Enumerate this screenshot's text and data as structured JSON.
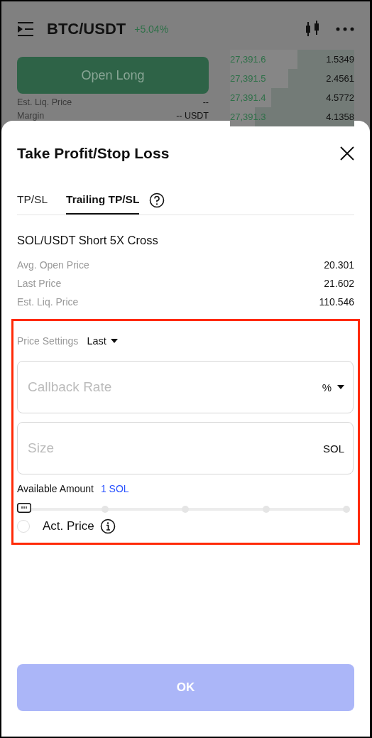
{
  "header": {
    "pair": "BTC/USDT",
    "change": "+5.04%"
  },
  "trade": {
    "button": "Open Long",
    "rows": [
      {
        "label": "Est. Liq. Price",
        "value": "--"
      },
      {
        "label": "Margin",
        "value": "-- USDT"
      }
    ]
  },
  "order_book": [
    {
      "price": "27,391.6",
      "amount": "1.5349",
      "level": 0.46
    },
    {
      "price": "27,391.5",
      "amount": "2.4561",
      "level": 0.53
    },
    {
      "price": "27,391.4",
      "amount": "4.5772",
      "level": 0.67
    },
    {
      "price": "27,391.3",
      "amount": "4.1358",
      "level": 0.8
    }
  ],
  "sheet": {
    "title": "Take Profit/Stop Loss",
    "tabs": [
      {
        "label": "TP/SL",
        "selected": false
      },
      {
        "label": "Trailing TP/SL",
        "selected": true
      }
    ],
    "position": "SOL/USDT Short 5X Cross",
    "details": [
      {
        "label": "Avg. Open Price",
        "value": "20.301"
      },
      {
        "label": "Last Price",
        "value": "21.602"
      },
      {
        "label": "Est. Liq. Price",
        "value": "110.546"
      }
    ],
    "price_settings": {
      "label": "Price Settings",
      "value": "Last"
    },
    "fields": [
      {
        "placeholder": "Callback Rate",
        "unit": "%",
        "dropdown": true
      },
      {
        "placeholder": "Size",
        "unit": "SOL",
        "dropdown": false
      }
    ],
    "available": {
      "label": "Available Amount",
      "value": "1 SOL"
    },
    "slider": {
      "level": 0
    },
    "act_price": {
      "label": "Act. Price",
      "checked": false
    },
    "ok": {
      "label": "OK",
      "disabled": true
    }
  }
}
